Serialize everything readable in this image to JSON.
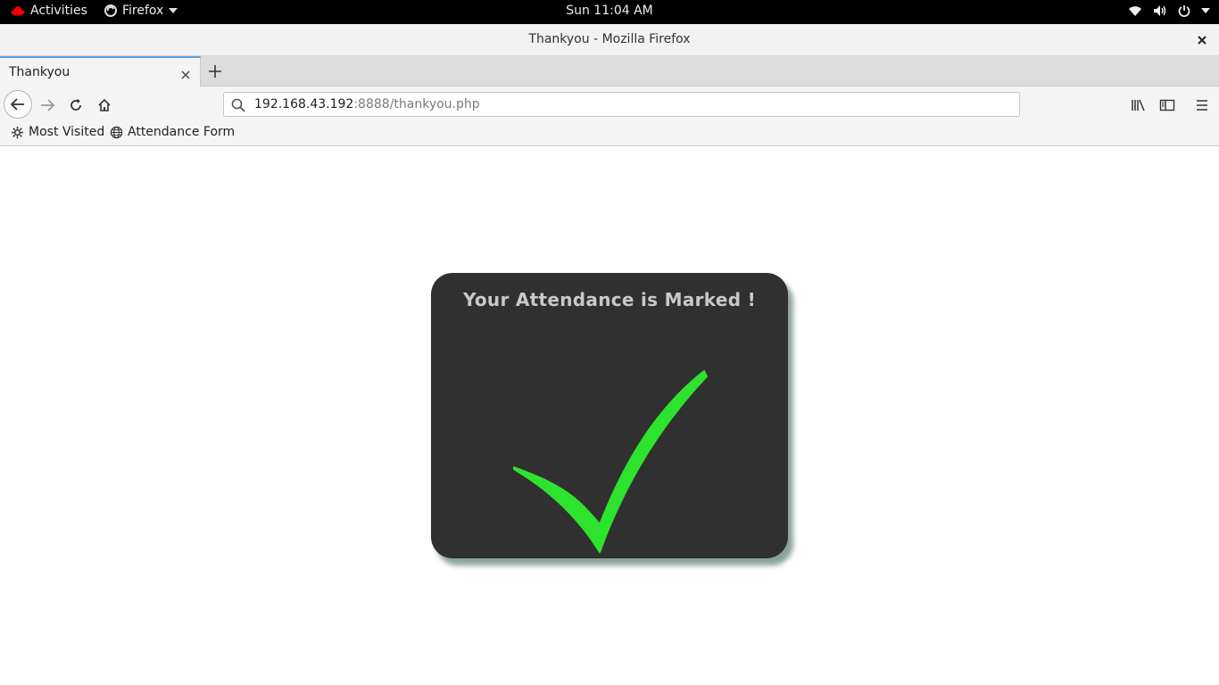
{
  "topbar": {
    "activities": "Activities",
    "app_menu": "Firefox",
    "clock": "Sun 11:04 AM"
  },
  "window": {
    "title": "Thankyou - Mozilla Firefox"
  },
  "tabs": [
    {
      "label": "Thankyou",
      "active": true
    }
  ],
  "urlbar": {
    "host": "192.168.43.192",
    "rest": ":8888/thankyou.php"
  },
  "bookmarks": [
    {
      "label": "Most Visited",
      "icon": "gear-icon"
    },
    {
      "label": "Attendance Form",
      "icon": "globe-icon"
    }
  ],
  "page": {
    "message": "Your Attendance is Marked !",
    "card_color": "#303030",
    "check_color": "#2ee32e",
    "check_icon": "checkmark-icon"
  }
}
